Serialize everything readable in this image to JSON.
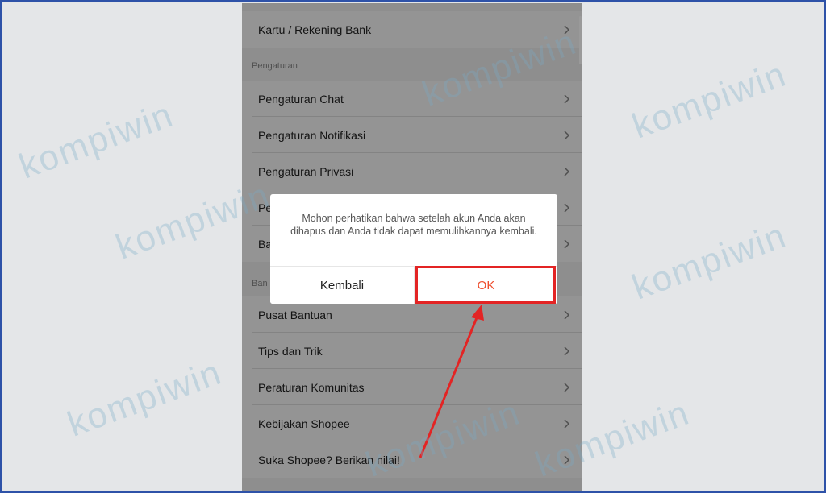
{
  "menu": {
    "rows": [
      {
        "label": "Kartu / Rekening Bank"
      },
      {
        "label": "Pengaturan Chat"
      },
      {
        "label": "Pengaturan Notifikasi"
      },
      {
        "label": "Pengaturan Privasi"
      },
      {
        "label": "Pe"
      },
      {
        "label": "Ba"
      },
      {
        "label": "Pusat Bantuan"
      },
      {
        "label": "Tips dan Trik"
      },
      {
        "label": "Peraturan Komunitas"
      },
      {
        "label": "Kebijakan Shopee"
      },
      {
        "label": "Suka Shopee? Berikan nilai!"
      }
    ],
    "section_pengaturan": "Pengaturan",
    "section_bantuan_partial": "Ban"
  },
  "dialog": {
    "message": "Mohon perhatikan bahwa setelah akun Anda akan dihapus dan Anda tidak dapat memulihkannya kembali.",
    "back_label": "Kembali",
    "ok_label": "OK"
  },
  "watermark": {
    "text": "kompiwin"
  },
  "colors": {
    "accent": "#ee4d2d",
    "highlight": "#e32424",
    "frame": "#2e52a8"
  },
  "icons": {
    "chevron": "chevron-right-icon",
    "watermark_logo": "kompiwin-logo-icon"
  }
}
